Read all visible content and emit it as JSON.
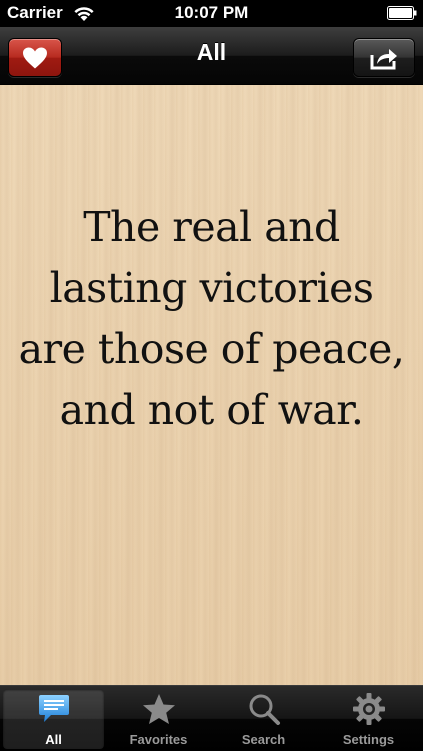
{
  "status_bar": {
    "carrier": "Carrier",
    "time": "10:07 PM"
  },
  "nav": {
    "title": "All",
    "left_button_icon": "heart-icon",
    "right_button_icon": "share-icon"
  },
  "quote": {
    "text": "The real and lasting victories are those of peace, and not of war."
  },
  "tabs": [
    {
      "label": "All",
      "icon": "chat-bubble-icon",
      "active": true
    },
    {
      "label": "Favorites",
      "icon": "star-icon",
      "active": false
    },
    {
      "label": "Search",
      "icon": "magnifier-icon",
      "active": false
    },
    {
      "label": "Settings",
      "icon": "gear-icon",
      "active": false
    }
  ],
  "colors": {
    "favorite_button": "#b62a1f",
    "active_tab_icon": "#4aa3f0",
    "paper": "#ecd4b1"
  }
}
